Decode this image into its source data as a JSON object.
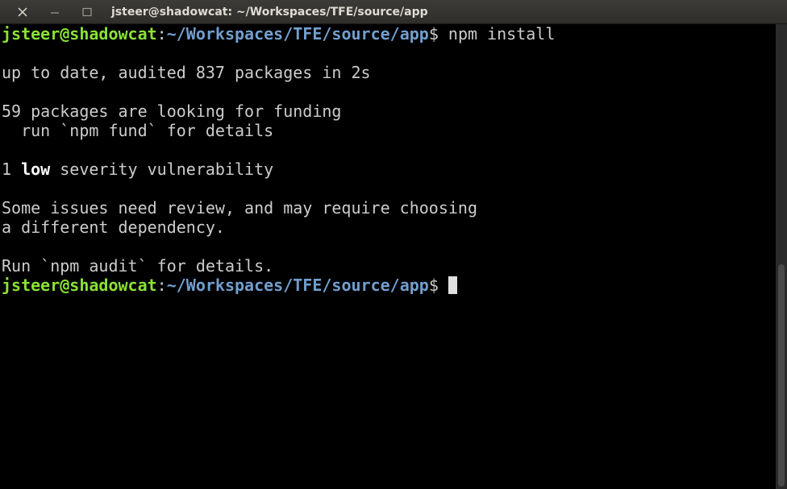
{
  "window": {
    "title": "jsteer@shadowcat: ~/Workspaces/TFE/source/app",
    "close_icon": "close-icon",
    "minimize_icon": "minimize-icon",
    "maximize_icon": "maximize-icon"
  },
  "prompt": {
    "user_host": "jsteer@shadowcat",
    "colon": ":",
    "path": "~/Workspaces/TFE/source/app",
    "symbol": "$ "
  },
  "output": {
    "command": "npm install",
    "line_uptodate": "up to date, audited 837 packages in 2s",
    "line_funding": "59 packages are looking for funding",
    "line_fund_details": "  run `npm fund` for details",
    "vuln_count": "1 ",
    "vuln_level": "low",
    "vuln_text": " severity vulnerability",
    "line_issues_1": "Some issues need review, and may require choosing",
    "line_issues_2": "a different dependency.",
    "line_audit": "Run `npm audit` for details."
  },
  "colors": {
    "background": "#000000",
    "text": "#cccccc",
    "user_host": "#8ae234",
    "path": "#729fcf",
    "titlebar": "#3c3b37"
  }
}
